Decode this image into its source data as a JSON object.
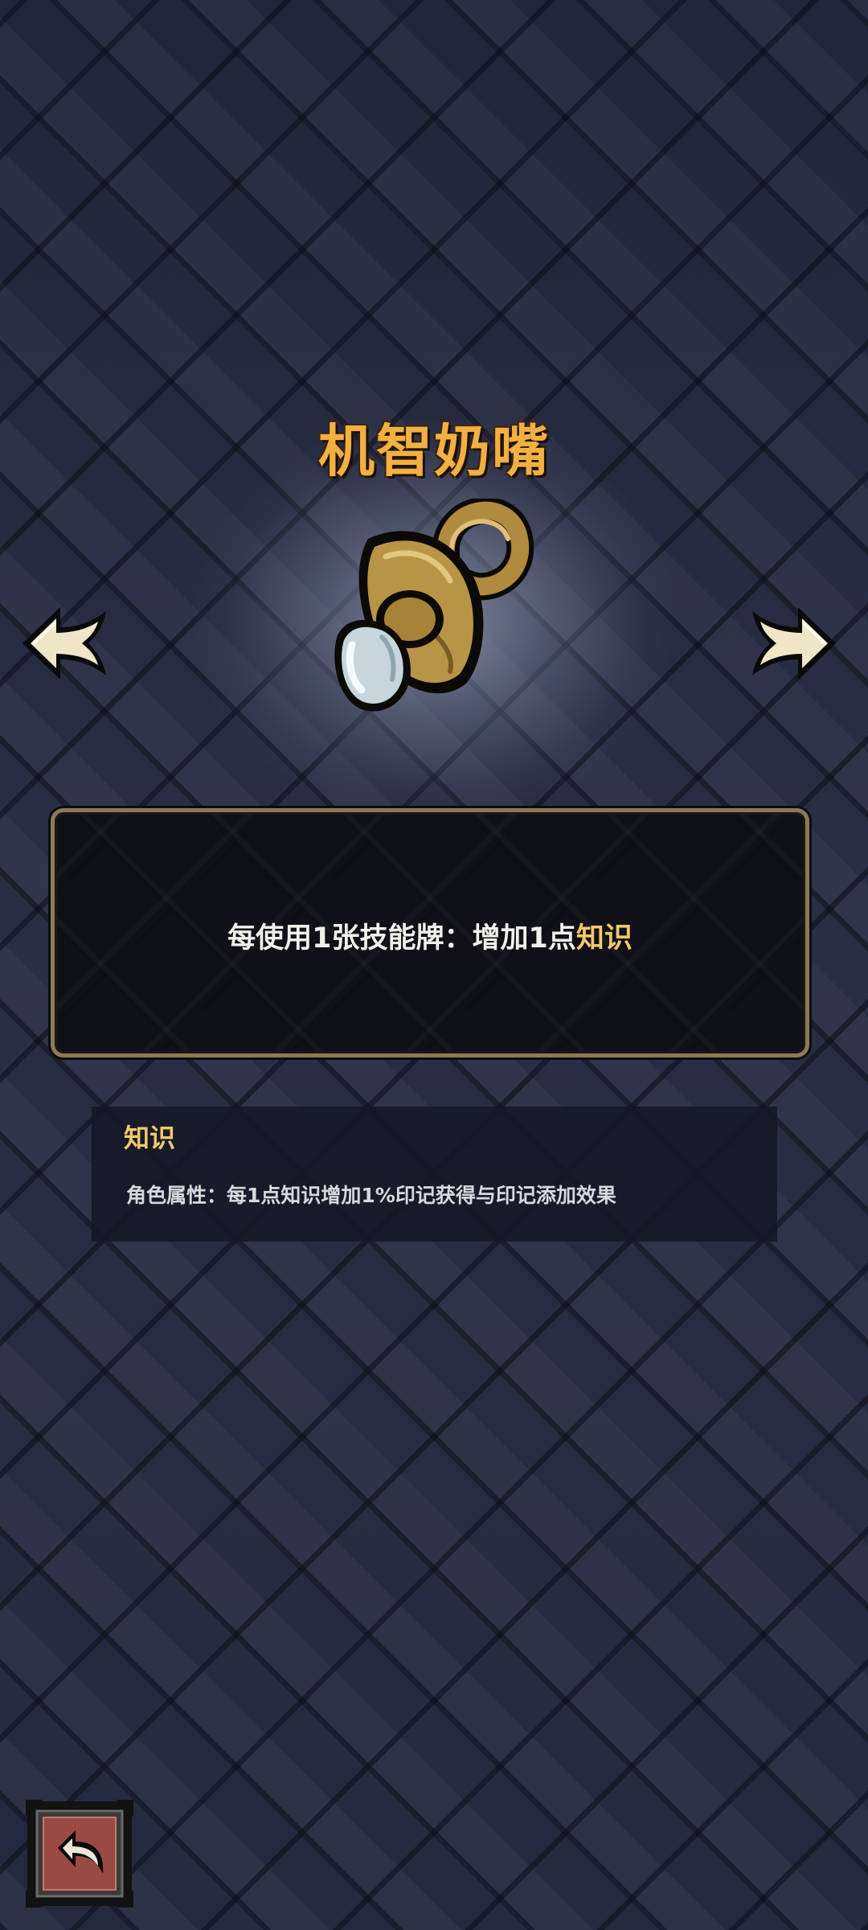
{
  "item": {
    "title": "机智奶嘴",
    "icon": "pacifier-icon"
  },
  "description": {
    "prefix": "每使用1张技能牌：增加1点",
    "keyword": "知识",
    "keyword_color": "#f2c96a"
  },
  "keyword_panel": {
    "title": "知识",
    "text": "角色属性：每1点知识增加1%印记获得与印记添加效果"
  },
  "nav": {
    "prev_icon": "left-arrow-icon",
    "next_icon": "right-arrow-icon",
    "back_icon": "return-icon"
  },
  "colors": {
    "title": "#f2b043",
    "frame": "#8a7a58",
    "background": "#262a3f",
    "back_button": "#9a4a44"
  }
}
